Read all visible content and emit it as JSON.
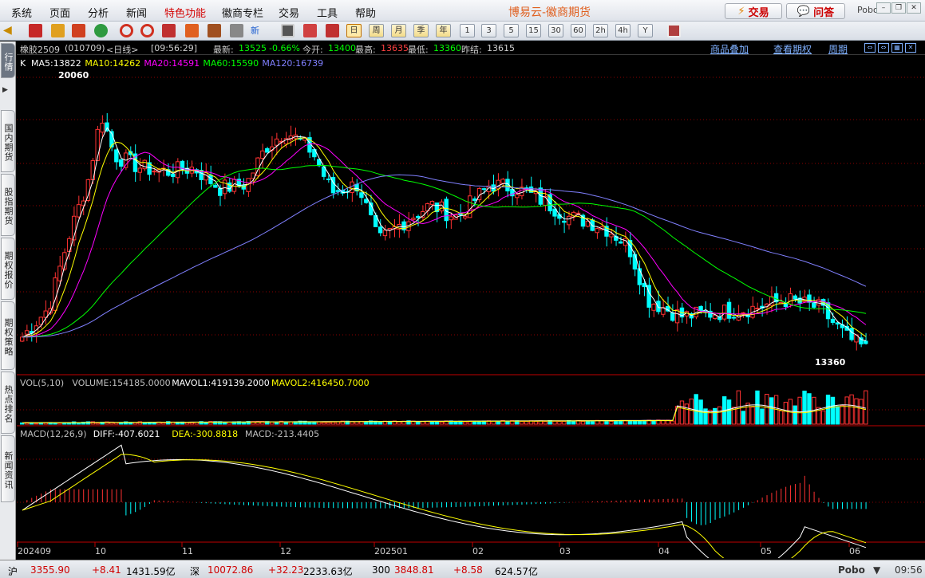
{
  "menu": [
    "系统",
    "页面",
    "分析",
    "新闻",
    "特色功能",
    "徽商专栏",
    "交易",
    "工具",
    "帮助"
  ],
  "menu_highlight_index": 4,
  "app_title": "博易云-徽商期货",
  "top_buttons": {
    "trade": "交易",
    "ask": "问答"
  },
  "broker": "Pobo",
  "toolbar_periods": [
    "日",
    "周",
    "月",
    "季",
    "年",
    "1",
    "3",
    "5",
    "15",
    "30",
    "60",
    "2h",
    "4h",
    "Y"
  ],
  "toolbar_active_period": "日",
  "left_tabs": [
    "行情",
    "国内期货",
    "股指期货",
    "期权报价",
    "期权策略",
    "热点排名",
    "新闻资讯"
  ],
  "info": {
    "symbol": "橡胶2509",
    "code": "(010709)",
    "period": "<日线>",
    "time": "[09:56:29]",
    "latest_label": "最新:",
    "latest": "13525",
    "change": "-0.66%",
    "open_label": "今开:",
    "open": "13400",
    "high_label": "最高:",
    "high": "13635",
    "low_label": "最低:",
    "low": "13360",
    "prev_label": "昨结:",
    "prev": "13615",
    "links": [
      "商品叠加",
      "查看期权",
      "周期"
    ]
  },
  "price_panel": {
    "label": "K",
    "ma": [
      {
        "text": "MA5:13822",
        "color": "#ffffff"
      },
      {
        "text": "MA10:14262",
        "color": "#ffff00"
      },
      {
        "text": "MA20:14591",
        "color": "#ff00ff"
      },
      {
        "text": "MA60:15590",
        "color": "#00ff00"
      },
      {
        "text": "MA120:16739",
        "color": "#8080ff"
      }
    ],
    "max_label": "20060",
    "min_label": "13360"
  },
  "volume_panel": {
    "items": [
      {
        "text": "VOL(5,10)",
        "color": "#c0c0c0"
      },
      {
        "text": "VOLUME:154185.0000",
        "color": "#c0c0c0"
      },
      {
        "text": "MAVOL1:419139.2000",
        "color": "#ffffff"
      },
      {
        "text": "MAVOL2:416450.7000",
        "color": "#ffff00"
      }
    ]
  },
  "macd_panel": {
    "items": [
      {
        "text": "MACD(12,26,9)",
        "color": "#c0c0c0"
      },
      {
        "text": "DIFF:-407.6021",
        "color": "#ffffff"
      },
      {
        "text": "DEA:-300.8818",
        "color": "#ffff00"
      },
      {
        "text": "MACD:-213.4405",
        "color": "#c0c0c0"
      }
    ]
  },
  "x_labels": [
    "202409",
    "10",
    "11",
    "12",
    "202501",
    "02",
    "03",
    "04",
    "05",
    "06"
  ],
  "status": {
    "sh_label": "沪",
    "sh_index": "3355.90",
    "sh_change": "+8.41",
    "sh_amount": "1431.59亿",
    "sz_label": "深",
    "sz_index": "10072.86",
    "sz_change": "+32.23",
    "sz_amount": "2233.63亿",
    "c300_label": "300",
    "c300_index": "3848.81",
    "c300_change": "+8.58",
    "c300_amount": "624.57亿",
    "brand": "Pobo",
    "clock": "09:56"
  },
  "colors": {
    "up": "#ff3232",
    "down": "#00ffff",
    "grid": "#8b0000",
    "axis": "#c00000"
  }
}
